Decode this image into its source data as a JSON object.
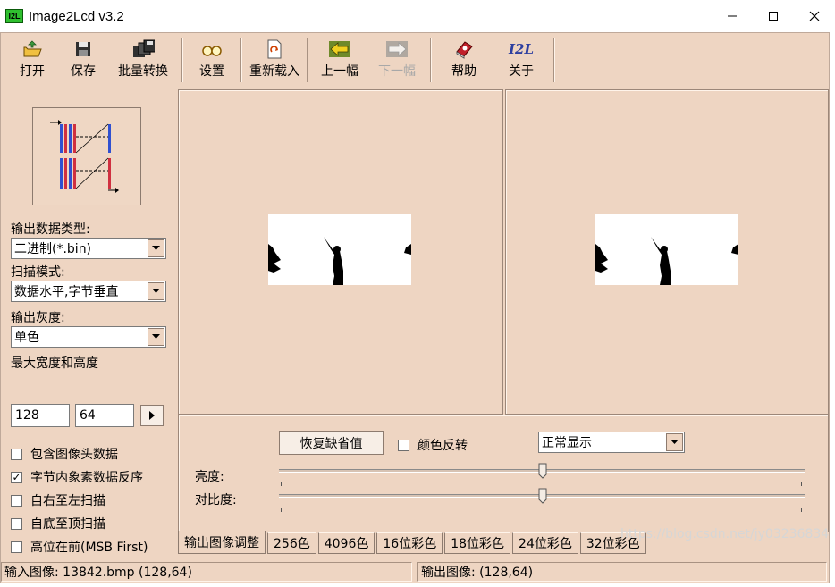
{
  "window": {
    "title": "Image2Lcd v3.2",
    "app_icon_text": "I2L"
  },
  "toolbar": {
    "open": "打开",
    "save": "保存",
    "batch": "批量转换",
    "settings": "设置",
    "reload": "重新载入",
    "prev": "上一幅",
    "next": "下一幅",
    "help": "帮助",
    "about": "关于",
    "about_icon_text": "I2L"
  },
  "left": {
    "output_type_label": "输出数据类型:",
    "output_type_value": "二进制(*.bin)",
    "scan_mode_label": "扫描模式:",
    "scan_mode_value": "数据水平,字节垂直",
    "gray_label": "输出灰度:",
    "gray_value": "单色",
    "max_size_label": "最大宽度和高度",
    "max_width": "128",
    "max_height": "64",
    "options": [
      {
        "label": "包含图像头数据",
        "checked": false
      },
      {
        "label": "字节内象素数据反序",
        "checked": true
      },
      {
        "label": "自右至左扫描",
        "checked": false
      },
      {
        "label": "自底至顶扫描",
        "checked": false
      },
      {
        "label": "高位在前(MSB First)",
        "checked": false
      }
    ]
  },
  "adjust": {
    "restore_default": "恢复缺省值",
    "invert_label": "颜色反转",
    "invert_checked": false,
    "display_mode": "正常显示",
    "brightness_label": "亮度:",
    "contrast_label": "对比度:",
    "brightness_level": 0.5,
    "contrast_level": 0.5
  },
  "tabs": [
    "输出图像调整",
    "256色",
    "4096色",
    "16位彩色",
    "18位彩色",
    "24位彩色",
    "32位彩色"
  ],
  "status": {
    "input": "输入图像: 13842.bmp (128,64)",
    "output": "输出图像: (128,64)"
  },
  "watermark": "https://blog.csdn.net/jy03236834"
}
